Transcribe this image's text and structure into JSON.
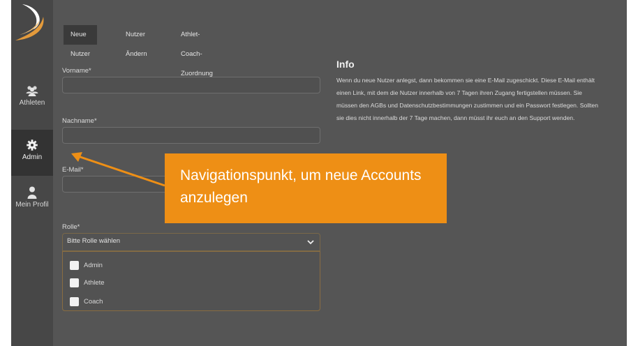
{
  "sidebar": {
    "items": [
      {
        "label": "Athleten",
        "icon": "users-icon"
      },
      {
        "label": "Admin",
        "icon": "gear-icon"
      },
      {
        "label": "Mein Profil",
        "icon": "person-icon"
      }
    ],
    "active": "Admin"
  },
  "tabs": [
    {
      "label": "Neue Nutzer"
    },
    {
      "label": "Nutzer Ändern"
    },
    {
      "label": "Athlet-Coach-Zuordnung"
    }
  ],
  "form": {
    "vorname_label": "Vorname*",
    "nachname_label": "Nachname*",
    "email_label": "E-Mail*",
    "rolle_label": "Rolle*",
    "rolle_placeholder": "Bitte Rolle wählen",
    "rolle_options": [
      "Admin",
      "Athlete",
      "Coach"
    ]
  },
  "info": {
    "title": "Info",
    "text": "Wenn du neue Nutzer anlegst, dann bekommen sie eine E-Mail zugeschickt. Diese E-Mail enthält einen Link, mit dem die Nutzer innerhalb von 7 Tagen ihren Zugang fertigstellen müssen. Sie müssen den AGBs und Datenschutzbestimmungen zustimmen und ein Passwort festlegen. Sollten sie dies nicht innerhalb der 7 Tage machen, dann müsst ihr euch an den Support wenden."
  },
  "callout": {
    "text": "Navigationspunkt, um neue Accounts anzulegen"
  },
  "colors": {
    "accent": "#ee8f15",
    "background": "#555555",
    "sidebar": "#474747"
  }
}
